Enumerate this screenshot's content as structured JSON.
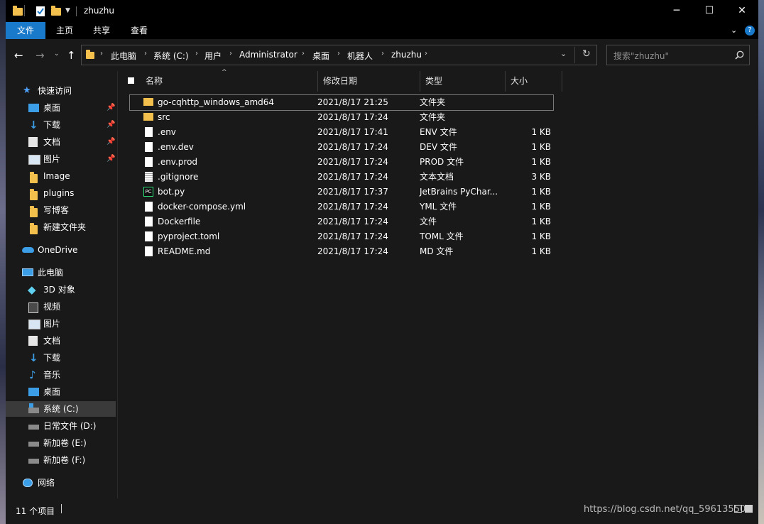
{
  "window": {
    "title": "zhuzhu",
    "controls": {
      "minimize": "─",
      "maximize": "☐",
      "close": "✕"
    }
  },
  "ribbon": {
    "tabs": [
      {
        "label": "文件",
        "active": true
      },
      {
        "label": "主页"
      },
      {
        "label": "共享"
      },
      {
        "label": "查看"
      }
    ]
  },
  "address": {
    "crumbs": [
      "此电脑",
      "系统 (C:)",
      "用户",
      "Administrator",
      "桌面",
      "机器人",
      "zhuzhu"
    ],
    "search_placeholder": "搜索\"zhuzhu\""
  },
  "navpane": {
    "quick_access": {
      "label": "快速访问",
      "items": [
        {
          "label": "桌面",
          "icon": "desktop-icon",
          "pinned": true
        },
        {
          "label": "下载",
          "icon": "download-icon",
          "pinned": true
        },
        {
          "label": "文档",
          "icon": "documents-icon",
          "pinned": true
        },
        {
          "label": "图片",
          "icon": "pictures-icon",
          "pinned": true
        },
        {
          "label": "Image",
          "icon": "folder-icon"
        },
        {
          "label": "plugins",
          "icon": "folder-icon"
        },
        {
          "label": "写博客",
          "icon": "folder-icon"
        },
        {
          "label": "新建文件夹",
          "icon": "folder-icon"
        }
      ]
    },
    "onedrive": {
      "label": "OneDrive"
    },
    "this_pc": {
      "label": "此电脑",
      "items": [
        {
          "label": "3D 对象",
          "icon": "3d-objects-icon"
        },
        {
          "label": "视频",
          "icon": "videos-icon"
        },
        {
          "label": "图片",
          "icon": "pictures-icon"
        },
        {
          "label": "文档",
          "icon": "documents-icon"
        },
        {
          "label": "下载",
          "icon": "download-icon"
        },
        {
          "label": "音乐",
          "icon": "music-icon"
        },
        {
          "label": "桌面",
          "icon": "desktop-icon"
        },
        {
          "label": "系统 (C:)",
          "icon": "drive-icon",
          "selected": true
        },
        {
          "label": "日常文件 (D:)",
          "icon": "drive-icon"
        },
        {
          "label": "新加卷 (E:)",
          "icon": "drive-icon"
        },
        {
          "label": "新加卷 (F:)",
          "icon": "drive-icon"
        }
      ]
    },
    "network": {
      "label": "网络"
    }
  },
  "filelist": {
    "columns": {
      "name": "名称",
      "modified": "修改日期",
      "type": "类型",
      "size": "大小"
    },
    "rows": [
      {
        "name": "go-cqhttp_windows_amd64",
        "modified": "2021/8/17 21:25",
        "type": "文件夹",
        "size": "",
        "icon": "folder"
      },
      {
        "name": "src",
        "modified": "2021/8/17 17:24",
        "type": "文件夹",
        "size": "",
        "icon": "folder"
      },
      {
        "name": ".env",
        "modified": "2021/8/17 17:41",
        "type": "ENV 文件",
        "size": "1 KB",
        "icon": "file"
      },
      {
        "name": ".env.dev",
        "modified": "2021/8/17 17:24",
        "type": "DEV 文件",
        "size": "1 KB",
        "icon": "file"
      },
      {
        "name": ".env.prod",
        "modified": "2021/8/17 17:24",
        "type": "PROD 文件",
        "size": "1 KB",
        "icon": "file"
      },
      {
        "name": ".gitignore",
        "modified": "2021/8/17 17:24",
        "type": "文本文档",
        "size": "3 KB",
        "icon": "text"
      },
      {
        "name": "bot.py",
        "modified": "2021/8/17 17:37",
        "type": "JetBrains PyChar...",
        "size": "1 KB",
        "icon": "pycharm"
      },
      {
        "name": "docker-compose.yml",
        "modified": "2021/8/17 17:24",
        "type": "YML 文件",
        "size": "1 KB",
        "icon": "file"
      },
      {
        "name": "Dockerfile",
        "modified": "2021/8/17 17:24",
        "type": "文件",
        "size": "1 KB",
        "icon": "file"
      },
      {
        "name": "pyproject.toml",
        "modified": "2021/8/17 17:24",
        "type": "TOML 文件",
        "size": "1 KB",
        "icon": "file"
      },
      {
        "name": "README.md",
        "modified": "2021/8/17 17:24",
        "type": "MD 文件",
        "size": "1 KB",
        "icon": "file"
      }
    ]
  },
  "statusbar": {
    "count": "11 个项目",
    "watermark": "https://blog.csdn.net/qq_59613550"
  }
}
